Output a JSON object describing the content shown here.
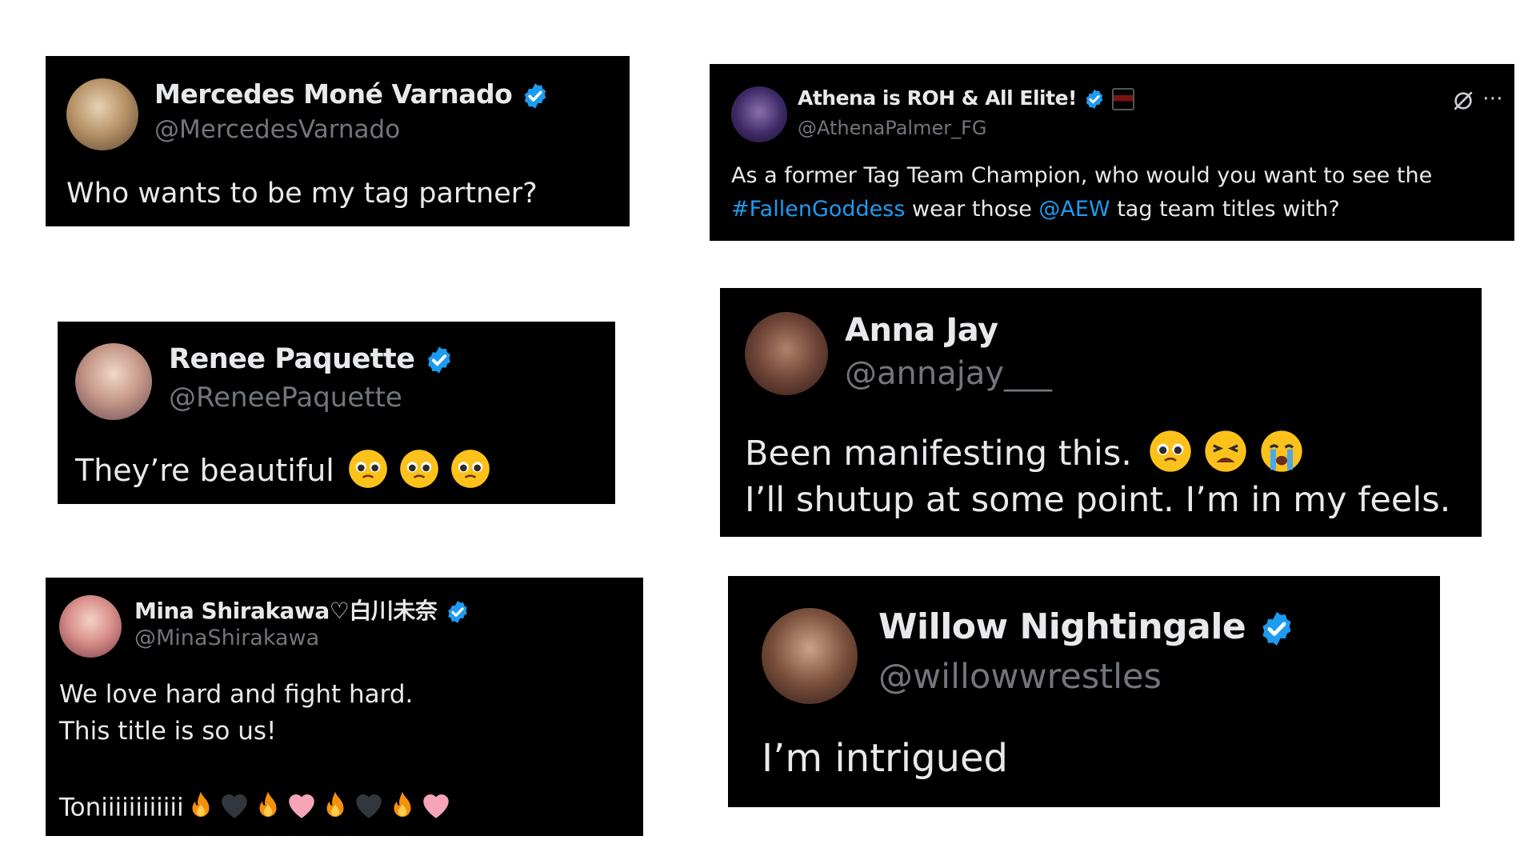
{
  "tweets": [
    {
      "name": "Mercedes Moné Varnado",
      "handle": "@MercedesVarnado",
      "verified": true,
      "text": "Who wants to be my tag partner?"
    },
    {
      "name": "Athena is ROH & All Elite!",
      "handle": "@AthenaPalmer_FG",
      "verified": true,
      "text_line1": "As a former Tag Team Champion, who would you want to see the",
      "hashtag": "#FallenGoddess",
      "mid_text": " wear those ",
      "mention": "@AEW",
      "end_text": " tag team titles with?",
      "icons": [
        "grok-icon",
        "more-icon"
      ]
    },
    {
      "name": "Renee Paquette",
      "handle": "@ReneePaquette",
      "verified": true,
      "text": "They’re beautiful",
      "emojis": [
        "pleading-face",
        "pleading-face",
        "pleading-face"
      ]
    },
    {
      "name": "Anna Jay",
      "handle": "@annajay___",
      "verified": false,
      "text_line1": "Been manifesting this.",
      "emojis": [
        "pleading-face",
        "tired-face",
        "crying-face"
      ],
      "text_line2": "I’ll shutup at some point. I’m in my feels."
    },
    {
      "name": "Mina Shirakawa♡白川未奈",
      "handle": "@MinaShirakawa",
      "verified": true,
      "text_line1": "We love hard and fight hard.",
      "text_line2": "This title is so us!",
      "text_line3": "Toniiiiiiiiiiii",
      "emojis": [
        "fire",
        "black-heart",
        "fire",
        "pink-heart",
        "fire",
        "black-heart",
        "fire",
        "pink-heart"
      ]
    },
    {
      "name": "Willow Nightingale",
      "handle": "@willowwrestles",
      "verified": true,
      "text": "I’m intrigued"
    }
  ],
  "colors": {
    "card_bg": "#000000",
    "text": "#e7e9ea",
    "handle": "#71767b",
    "link": "#1d9bf0",
    "verified": "#1d9bf0"
  }
}
